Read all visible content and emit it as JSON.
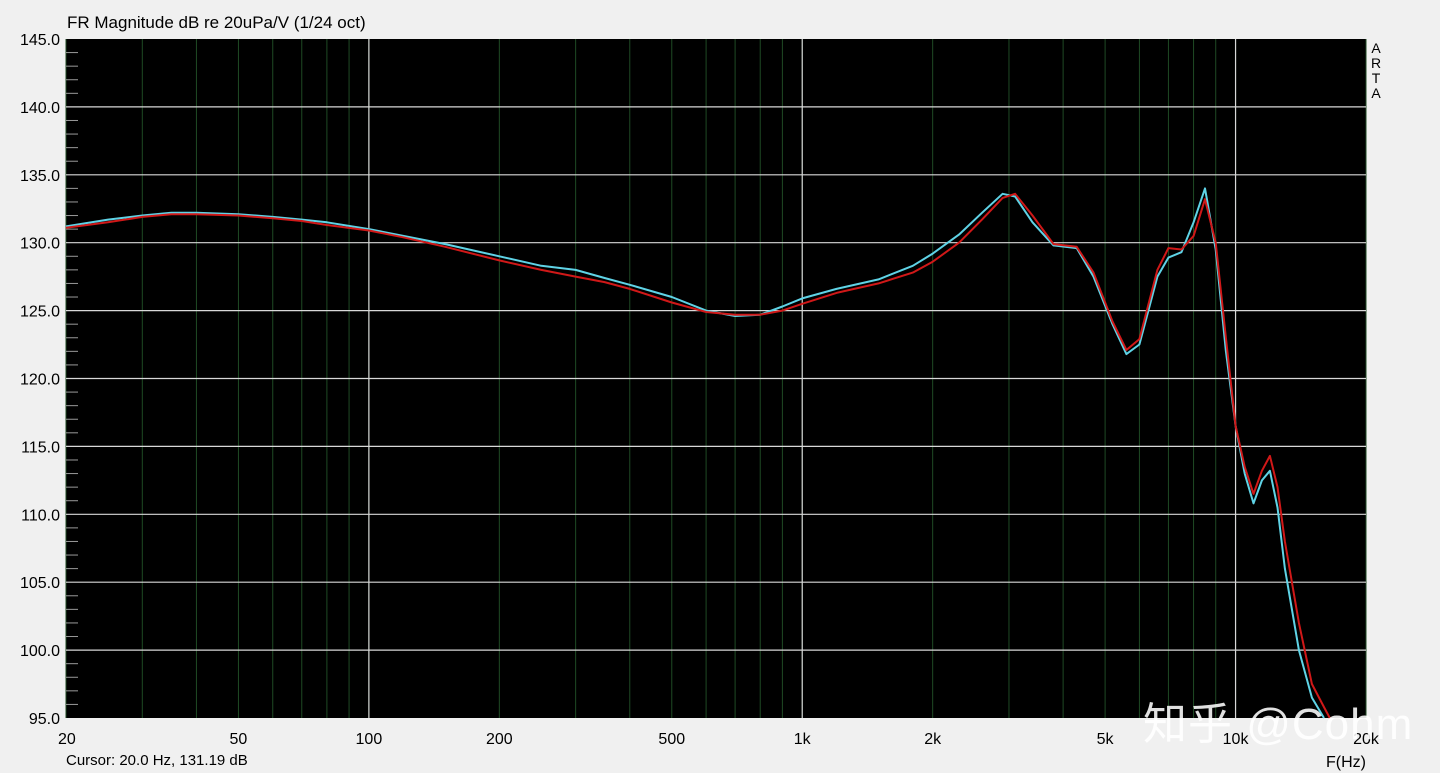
{
  "chart_data": {
    "type": "line",
    "title": "FR Magnitude dB re 20uPa/V (1/24 oct)",
    "xlabel": "F(Hz)",
    "ylabel": "",
    "x_scale": "log",
    "xlim": [
      20,
      20000
    ],
    "ylim": [
      95,
      145
    ],
    "grid": true,
    "x_tick_labels": [
      {
        "value": 20,
        "label": "20"
      },
      {
        "value": 50,
        "label": "50"
      },
      {
        "value": 100,
        "label": "100"
      },
      {
        "value": 200,
        "label": "200"
      },
      {
        "value": 500,
        "label": "500"
      },
      {
        "value": 1000,
        "label": "1k"
      },
      {
        "value": 2000,
        "label": "2k"
      },
      {
        "value": 5000,
        "label": "5k"
      },
      {
        "value": 10000,
        "label": "10k"
      },
      {
        "value": 20000,
        "label": "20k"
      }
    ],
    "y_ticks": [
      95.0,
      100.0,
      105.0,
      110.0,
      115.0,
      120.0,
      125.0,
      130.0,
      135.0,
      140.0,
      145.0
    ],
    "y_tick_labels": [
      "95.0",
      "100.0",
      "105.0",
      "110.0",
      "115.0",
      "120.0",
      "125.0",
      "130.0",
      "135.0",
      "140.0",
      "145.0"
    ],
    "background": "#000000",
    "series": [
      {
        "color": "#5fd3e6",
        "points": [
          [
            20,
            131.2
          ],
          [
            25,
            131.7
          ],
          [
            30,
            132.0
          ],
          [
            35,
            132.2
          ],
          [
            40,
            132.2
          ],
          [
            50,
            132.1
          ],
          [
            60,
            131.9
          ],
          [
            70,
            131.7
          ],
          [
            80,
            131.5
          ],
          [
            100,
            131.0
          ],
          [
            120,
            130.5
          ],
          [
            150,
            129.9
          ],
          [
            200,
            129.0
          ],
          [
            250,
            128.3
          ],
          [
            300,
            128.0
          ],
          [
            350,
            127.4
          ],
          [
            400,
            126.9
          ],
          [
            500,
            126.0
          ],
          [
            600,
            125.0
          ],
          [
            700,
            124.6
          ],
          [
            800,
            124.7
          ],
          [
            900,
            125.3
          ],
          [
            1000,
            125.9
          ],
          [
            1200,
            126.6
          ],
          [
            1500,
            127.3
          ],
          [
            1800,
            128.3
          ],
          [
            2000,
            129.2
          ],
          [
            2300,
            130.6
          ],
          [
            2600,
            132.2
          ],
          [
            2900,
            133.6
          ],
          [
            3100,
            133.4
          ],
          [
            3400,
            131.5
          ],
          [
            3800,
            129.8
          ],
          [
            4300,
            129.6
          ],
          [
            4700,
            127.5
          ],
          [
            5200,
            124.0
          ],
          [
            5600,
            121.8
          ],
          [
            6000,
            122.5
          ],
          [
            6600,
            127.5
          ],
          [
            7000,
            128.9
          ],
          [
            7500,
            129.3
          ],
          [
            8000,
            131.5
          ],
          [
            8500,
            134.0
          ],
          [
            9000,
            129.5
          ],
          [
            9500,
            122.0
          ],
          [
            10000,
            116.5
          ],
          [
            10500,
            113.0
          ],
          [
            11000,
            110.8
          ],
          [
            11500,
            112.5
          ],
          [
            12000,
            113.2
          ],
          [
            12500,
            110.5
          ],
          [
            13000,
            106.0
          ],
          [
            14000,
            100.0
          ],
          [
            15000,
            96.5
          ],
          [
            16000,
            95.0
          ]
        ]
      },
      {
        "color": "#d01818",
        "points": [
          [
            20,
            131.1
          ],
          [
            25,
            131.5
          ],
          [
            30,
            131.9
          ],
          [
            35,
            132.1
          ],
          [
            40,
            132.1
          ],
          [
            50,
            132.0
          ],
          [
            60,
            131.8
          ],
          [
            70,
            131.6
          ],
          [
            80,
            131.3
          ],
          [
            100,
            130.9
          ],
          [
            120,
            130.4
          ],
          [
            150,
            129.7
          ],
          [
            200,
            128.7
          ],
          [
            250,
            128.0
          ],
          [
            300,
            127.5
          ],
          [
            350,
            127.1
          ],
          [
            400,
            126.6
          ],
          [
            500,
            125.6
          ],
          [
            600,
            124.9
          ],
          [
            700,
            124.7
          ],
          [
            800,
            124.7
          ],
          [
            900,
            125.0
          ],
          [
            1000,
            125.5
          ],
          [
            1200,
            126.3
          ],
          [
            1500,
            127.0
          ],
          [
            1800,
            127.8
          ],
          [
            2000,
            128.6
          ],
          [
            2300,
            130.0
          ],
          [
            2600,
            131.7
          ],
          [
            2900,
            133.3
          ],
          [
            3100,
            133.6
          ],
          [
            3400,
            132.0
          ],
          [
            3800,
            129.9
          ],
          [
            4300,
            129.7
          ],
          [
            4700,
            127.8
          ],
          [
            5200,
            124.2
          ],
          [
            5600,
            122.1
          ],
          [
            6000,
            122.9
          ],
          [
            6600,
            128.0
          ],
          [
            7000,
            129.6
          ],
          [
            7500,
            129.5
          ],
          [
            8000,
            130.5
          ],
          [
            8500,
            133.2
          ],
          [
            9000,
            130.0
          ],
          [
            9500,
            123.0
          ],
          [
            10000,
            116.5
          ],
          [
            10500,
            113.5
          ],
          [
            11000,
            111.5
          ],
          [
            11500,
            113.2
          ],
          [
            12000,
            114.3
          ],
          [
            12500,
            112.0
          ],
          [
            13000,
            108.0
          ],
          [
            14000,
            102.0
          ],
          [
            15000,
            97.5
          ],
          [
            16000,
            95.8
          ],
          [
            16500,
            95.0
          ]
        ]
      }
    ]
  },
  "cursor_readout": "Cursor: 20.0 Hz, 131.19 dB",
  "brand_letters": [
    "A",
    "R",
    "T",
    "A"
  ],
  "watermark_text": "知乎 @Cohm"
}
